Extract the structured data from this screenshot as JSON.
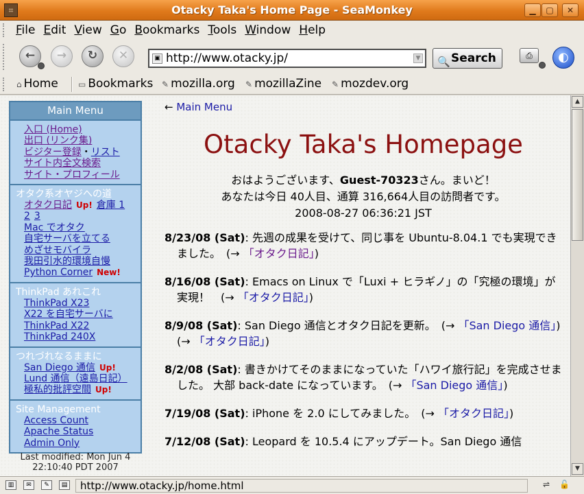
{
  "window": {
    "title": "Otacky Taka's Home Page - SeaMonkey"
  },
  "menubar": [
    {
      "key": "F",
      "rest": "ile"
    },
    {
      "key": "E",
      "rest": "dit"
    },
    {
      "key": "V",
      "rest": "iew"
    },
    {
      "key": "G",
      "rest": "o"
    },
    {
      "key": "B",
      "rest": "ookmarks"
    },
    {
      "key": "T",
      "rest": "ools"
    },
    {
      "key": "W",
      "rest": "indow"
    },
    {
      "key": "H",
      "rest": "elp"
    }
  ],
  "navbar": {
    "url": "http://www.otacky.jp/",
    "search_label": "Search"
  },
  "personal_toolbar": {
    "home": "Home",
    "bookmarks": "Bookmarks",
    "links": [
      "mozilla.org",
      "mozillaZine",
      "mozdev.org"
    ]
  },
  "sidebar": {
    "header": "Main Menu",
    "sec1": {
      "home": "入口 (Home)",
      "exit": "出口 (リンク集)",
      "visitor_reg": "ビジター登録",
      "visitor_sep": "・",
      "visitor_list": "リスト",
      "search": "サイト内全文検索",
      "profile": "サイト・プロフィール"
    },
    "sec2": {
      "title": "オタク系オヤジへの道",
      "diary": "オタク日記",
      "up": "Up!",
      "warehouse": "倉庫 1",
      "page2": "2",
      "page3": "3",
      "mac": "Mac でオタク",
      "server": "自宅サーバを立てる",
      "mobile": "めざせモバイラ",
      "selfpraise": "我田引水的環境自慢",
      "python": "Python Corner",
      "new": "New!"
    },
    "sec3": {
      "title": "ThinkPad あれこれ",
      "x23": "ThinkPad X23",
      "x22server": "X22 を自宅サーバに",
      "x22": "ThinkPad X22",
      "t240x": "ThinkPad 240X"
    },
    "sec4": {
      "title": "つれづれなるままに",
      "sandiego": "San Diego 通信",
      "up1": "Up!",
      "lund": "Lund 通信（遠島日記）",
      "critique": "極私的批評空間",
      "up2": "Up!"
    },
    "sec5": {
      "title": "Site Management",
      "access": "Access Count",
      "apache": "Apache Status",
      "admin": "Admin Only"
    },
    "last_modified_1": "Last modified: Mon Jun 4",
    "last_modified_2": "22:10:40 PDT 2007"
  },
  "main": {
    "back_arrow": "←",
    "back_link": "Main Menu",
    "page_title": "Otacky Taka's Homepage",
    "greet1_pre": "おはようございます、",
    "greet1_user": "Guest-70323",
    "greet1_post": "さん。まいど！",
    "greet2": "あなたは今日 40人目、通算 316,664人目の訪問者です。",
    "greet3": "2008-08-27 06:36:21 JST",
    "entries": {
      "e1": {
        "date": "8/23/08 (Sat)",
        "text": ": 先週の成果を受けて、同じ事を Ubuntu-8.04.1 でも実現できました。　(→ ",
        "link": "「オタク日記」",
        "tail": ")"
      },
      "e2": {
        "date": "8/16/08 (Sat)",
        "text": ": Emacs on Linux で「Luxi + ヒラギノ」の「究極の環境」が実現！　(→ ",
        "link": "「オタク日記」",
        "tail": ")"
      },
      "e3": {
        "date": "8/9/08 (Sat)",
        "text": ": San Diego 通信とオタク日記を更新。　(→ ",
        "link": "「San Diego 通信」",
        "mid": ")　(→ ",
        "link2": "「オタク日記」",
        "tail": ")"
      },
      "e4": {
        "date": "8/2/08 (Sat)",
        "text": ": 書きかけてそのままになっていた「ハワイ旅行記」を完成させました。 大部 back-date になっています。　(→ ",
        "link": "「San Diego 通信」",
        "tail": ")"
      },
      "e5": {
        "date": "7/19/08 (Sat)",
        "text": ": iPhone を 2.0 にしてみました。　(→ ",
        "link": "「オタク日記」",
        "tail": ")"
      },
      "e6": {
        "date": "7/12/08 (Sat)",
        "text": ": Leopard を 10.5.4 にアップデート。San Diego 通信"
      }
    }
  },
  "statusbar": {
    "text": "http://www.otacky.jp/home.html"
  }
}
